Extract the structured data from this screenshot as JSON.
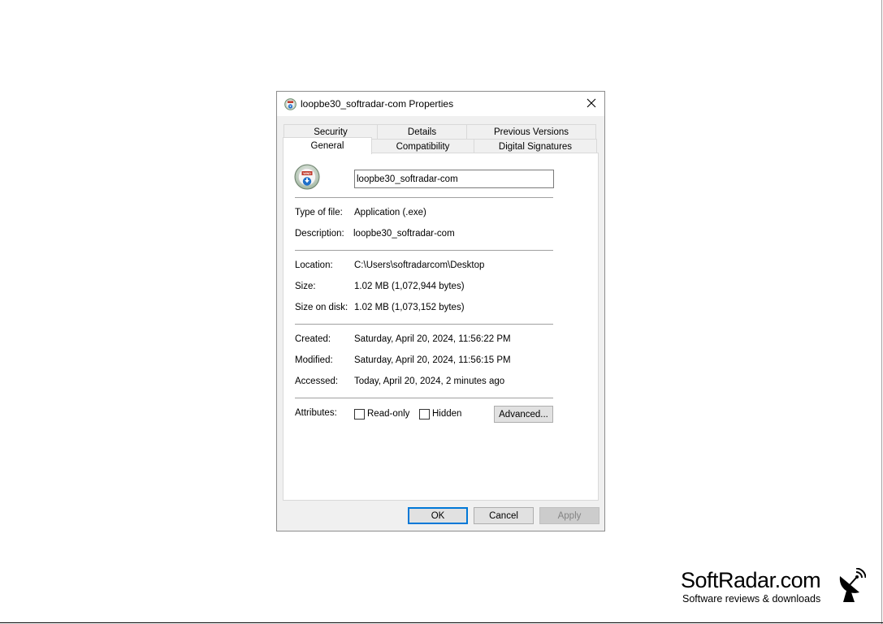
{
  "dialog": {
    "title": "loopbe30_softradar-com Properties",
    "close_symbol": "✕"
  },
  "tabs": [
    {
      "label": "Security"
    },
    {
      "label": "Details"
    },
    {
      "label": "Previous Versions"
    },
    {
      "label": "General"
    },
    {
      "label": "Compatibility"
    },
    {
      "label": "Digital Signatures"
    }
  ],
  "general": {
    "file_name": "loopbe30_softradar-com",
    "icon_label": "WIND",
    "type_label": "Type of file:",
    "type_value": "Application (.exe)",
    "description_label": "Description:",
    "description_value": "loopbe30_softradar-com",
    "location_label": "Location:",
    "location_value": "C:\\Users\\softradarcom\\Desktop",
    "size_label": "Size:",
    "size_value": "1.02 MB (1,072,944 bytes)",
    "size_on_disk_label": "Size on disk:",
    "size_on_disk_value": "1.02 MB (1,073,152 bytes)",
    "created_label": "Created:",
    "created_value": "Saturday, April 20, 2024, 11:56:22 PM",
    "modified_label": "Modified:",
    "modified_value": "Saturday, April 20, 2024, 11:56:15 PM",
    "accessed_label": "Accessed:",
    "accessed_value": "Today, April 20, 2024, 2 minutes ago",
    "attributes_label": "Attributes:",
    "readonly_label": "Read-only",
    "readonly_checked": false,
    "hidden_label": "Hidden",
    "hidden_checked": false,
    "advanced_label": "Advanced..."
  },
  "buttons": {
    "ok": "OK",
    "cancel": "Cancel",
    "apply": "Apply"
  },
  "watermark": {
    "name": "SoftRadar.com",
    "tagline": "Software reviews & downloads"
  },
  "colors": {
    "accent": "#0078d7",
    "dialog_bg": "#f0f0f0",
    "panel_bg": "#ffffff"
  },
  "icons": {
    "title": "app-icon",
    "file": "installer-icon",
    "close": "close-icon",
    "logo": "satellite-dish-icon"
  }
}
